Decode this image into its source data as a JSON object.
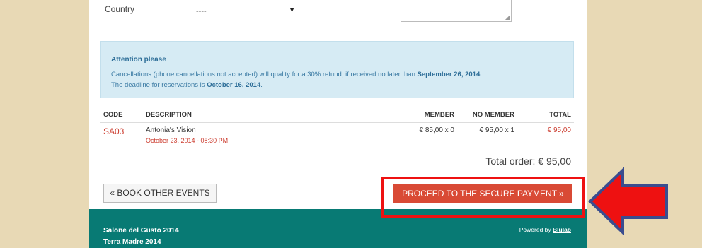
{
  "form": {
    "country_label": "Country",
    "country_value": "----"
  },
  "attention": {
    "title": "Attention please",
    "line1_prefix": "Cancellations (phone cancellations not accepted) will quality for a 30% refund, if received no later than ",
    "line1_date": "September 26, 2014",
    "line1_suffix": ".",
    "line2_prefix": "The deadline for reservations is ",
    "line2_date": "October 16, 2014",
    "line2_suffix": "."
  },
  "table": {
    "headers": {
      "code": "CODE",
      "description": "DESCRIPTION",
      "member": "MEMBER",
      "no_member": "NO MEMBER",
      "total": "TOTAL"
    },
    "rows": [
      {
        "code": "SA03",
        "description": "Antonia's Vision",
        "date": "October 23, 2014 - 08:30 PM",
        "member": "€ 85,00  x 0",
        "no_member": "€ 95,00  x 1",
        "total": "€ 95,00"
      }
    ]
  },
  "total_order": "Total order: € 95,00",
  "buttons": {
    "book_other": "« BOOK OTHER EVENTS",
    "proceed": "PROCEED TO THE SECURE PAYMENT »"
  },
  "footer": {
    "line1": "Salone del Gusto 2014",
    "line2": "Terra Madre 2014",
    "powered_prefix": "Powered by ",
    "powered_link": "Blulab"
  },
  "colors": {
    "accent_red": "#d94a35",
    "footer_teal": "#087a74",
    "annotation_red": "#ee1111",
    "annotation_arrow_outline": "#3a4d8f",
    "background": "#e8d9b5"
  }
}
